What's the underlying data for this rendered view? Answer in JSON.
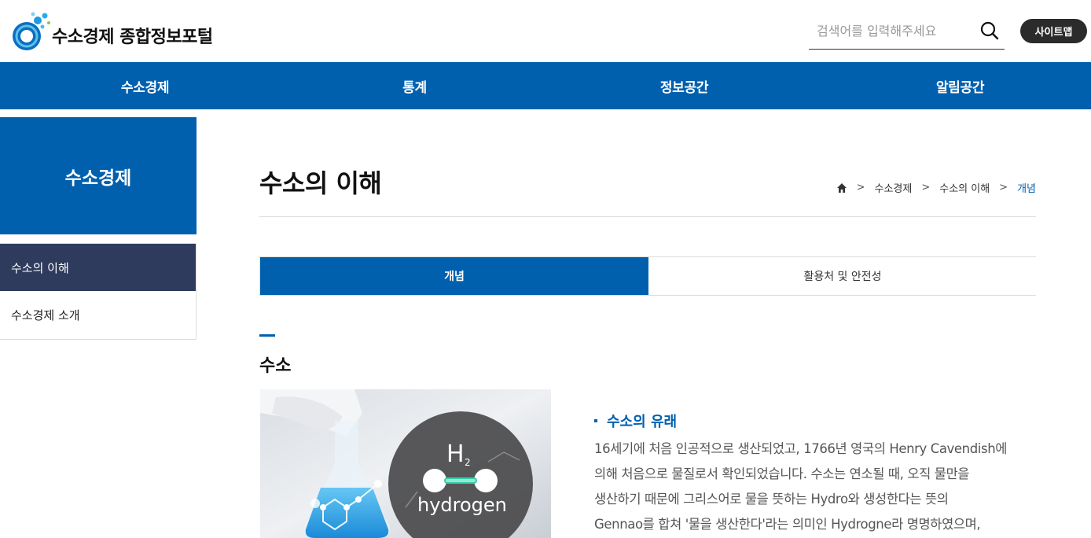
{
  "header": {
    "logo_text": "수소경제 종합정보포털",
    "search_placeholder": "검색어를 입력해주세요",
    "sitemap_label": "사이트맵"
  },
  "gnb": {
    "items": [
      "수소경제",
      "통계",
      "정보공간",
      "알림공간"
    ]
  },
  "sidebar": {
    "title": "수소경제",
    "items": [
      {
        "label": "수소의 이해",
        "active": true
      },
      {
        "label": "수소경제 소개",
        "active": false
      }
    ]
  },
  "main": {
    "page_title": "수소의 이해",
    "breadcrumb": [
      "수소경제",
      "수소의 이해",
      "개념"
    ],
    "tabs": [
      {
        "label": "개념",
        "active": true
      },
      {
        "label": "활용처 및 안전성",
        "active": false
      }
    ],
    "section_title": "수소",
    "image_text": {
      "formula": "H",
      "subscript": "2",
      "word": "hydrogen"
    },
    "sub_title": "수소의 유래",
    "body_lines": [
      "16세기에 처음 인공적으로 생산되었고, 1766년 영국의 Henry Cavendish에",
      "의해 처음으로 물질로서 확인되었습니다. 수소는 연소될 때, 오직 물만을",
      "생산하기 때문에 그리스어로 물을 뜻하는 Hydro와 생성한다는 뜻의",
      "Gennao를 합쳐 '물을 생산한다'라는 의미인 Hydrogne라 명명하였으며,"
    ]
  },
  "colors": {
    "brand_blue": "#0060ae",
    "sidebar_active": "#2f3b5d",
    "sitemap_bg": "#2b2b2b"
  },
  "icons": [
    "logo-icon",
    "search-icon",
    "home-icon",
    "chevron-right-icon"
  ]
}
